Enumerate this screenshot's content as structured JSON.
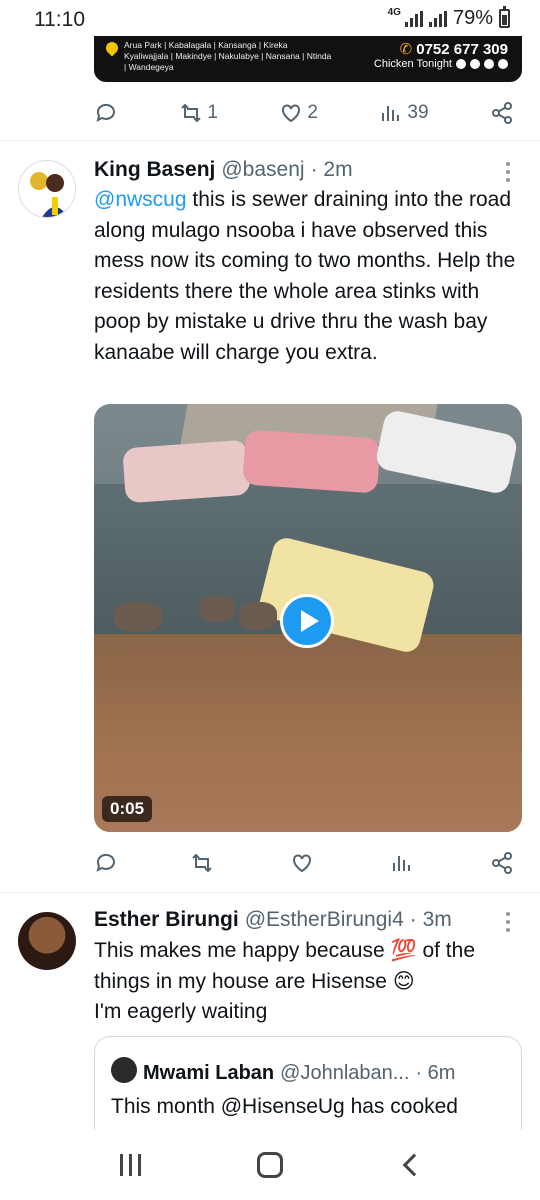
{
  "status_bar": {
    "time": "11:10",
    "network": "4G",
    "battery": "79%"
  },
  "ad_banner": {
    "locations": "Arua Park | Kabalagala | Kansanga | Kireka Kyaliwajjala | Makindye | Nakulabye | Nansana | Ntinda | Wandegeya",
    "phone": "0752 677 309",
    "brand": "Chicken Tonight"
  },
  "previous_tweet_actions": {
    "reply_count": "",
    "retweet_count": "1",
    "like_count": "2",
    "views_count": "39"
  },
  "tweet1": {
    "display_name": "King Basenj",
    "handle": "@basenj",
    "time": "· 2m",
    "mention": "@nwscug",
    "text": " this is sewer draining into the road along mulago nsooba i have observed this mess now its coming to two months. Help the residents there the whole area stinks with poop by mistake u drive thru the wash bay kanaabe will charge you extra.",
    "video_duration": "0:05",
    "actions": {
      "retweet_count": "",
      "like_count": "",
      "views_count": ""
    }
  },
  "tweet2": {
    "display_name": "Esther Birungi",
    "handle": "@EstherBirungi4",
    "time": "· 3m",
    "line1": "This makes me happy because 💯 of the",
    "line2": "things in my house are Hisense 😊",
    "line3": "I'm eagerly waiting",
    "quote": {
      "display_name": "Mwami Laban",
      "handle": "@Johnlaban...",
      "time": "· 6m",
      "text": "This month @HisenseUg  has cooked"
    }
  },
  "icons": [
    "reply-icon",
    "retweet-icon",
    "like-icon",
    "views-icon",
    "share-icon",
    "more-icon",
    "play-icon",
    "recent-apps-icon",
    "home-icon",
    "back-icon"
  ]
}
